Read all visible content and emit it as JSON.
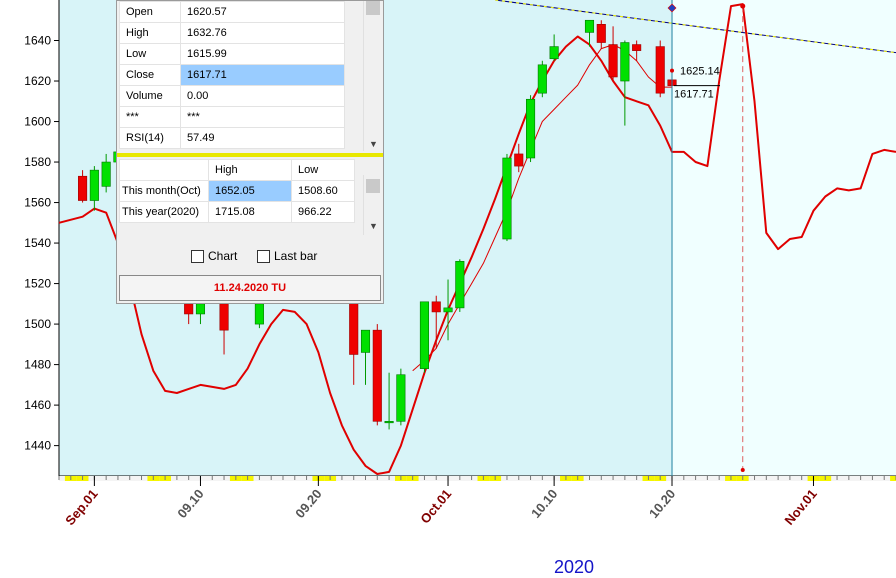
{
  "chart_data": {
    "type": "candlestick",
    "year_label": "2020",
    "x_tick_labels": [
      {
        "label": "Sep.01",
        "x": 0,
        "color": "#800000",
        "bold": true
      },
      {
        "label": "09.10",
        "x": 9,
        "color": "#555555",
        "bold": false
      },
      {
        "label": "09.20",
        "x": 19,
        "color": "#555555",
        "bold": false
      },
      {
        "label": "Oct.01",
        "x": 30,
        "color": "#800000",
        "bold": true
      },
      {
        "label": "10.10",
        "x": 39,
        "color": "#555555",
        "bold": false
      },
      {
        "label": "10.20",
        "x": 49,
        "color": "#555555",
        "bold": false
      },
      {
        "label": "Nov.01",
        "x": 61,
        "color": "#800000",
        "bold": true
      }
    ],
    "y_ticks": [
      1440,
      1460,
      1480,
      1500,
      1520,
      1540,
      1560,
      1580,
      1600,
      1620,
      1640
    ],
    "xlim": [
      -3,
      68
    ],
    "ylim": [
      1425,
      1660
    ],
    "candles": [
      {
        "x": -1,
        "open": 1573,
        "high": 1576,
        "low": 1560,
        "close": 1561
      },
      {
        "x": 0,
        "open": 1561,
        "high": 1578,
        "low": 1556,
        "close": 1576
      },
      {
        "x": 1,
        "open": 1568,
        "high": 1584,
        "low": 1565,
        "close": 1580
      },
      {
        "x": 2,
        "open": 1580,
        "high": 1590,
        "low": 1560,
        "close": 1585
      },
      {
        "x": 8,
        "open": 1510,
        "high": 1515,
        "low": 1500,
        "close": 1505
      },
      {
        "x": 9,
        "open": 1505,
        "high": 1515,
        "low": 1500,
        "close": 1510
      },
      {
        "x": 11,
        "open": 1510,
        "high": 1515,
        "low": 1485,
        "close": 1497
      },
      {
        "x": 14,
        "open": 1500,
        "high": 1512,
        "low": 1498,
        "close": 1510
      },
      {
        "x": 22,
        "open": 1515,
        "high": 1520,
        "low": 1470,
        "close": 1485
      },
      {
        "x": 23,
        "open": 1486,
        "high": 1497,
        "low": 1470,
        "close": 1497
      },
      {
        "x": 24,
        "open": 1497,
        "high": 1500,
        "low": 1450,
        "close": 1452
      },
      {
        "x": 25,
        "open": 1452,
        "high": 1476,
        "low": 1448,
        "close": 1452
      },
      {
        "x": 26,
        "open": 1452,
        "high": 1478,
        "low": 1450,
        "close": 1475
      },
      {
        "x": 28,
        "open": 1478,
        "high": 1510,
        "low": 1476,
        "close": 1511
      },
      {
        "x": 29,
        "open": 1511,
        "high": 1514,
        "low": 1488,
        "close": 1506
      },
      {
        "x": 30,
        "open": 1506,
        "high": 1522,
        "low": 1492,
        "close": 1508
      },
      {
        "x": 31,
        "open": 1508,
        "high": 1532,
        "low": 1506,
        "close": 1531
      },
      {
        "x": 35,
        "open": 1542,
        "high": 1584,
        "low": 1541,
        "close": 1582
      },
      {
        "x": 36,
        "open": 1584,
        "high": 1589,
        "low": 1575,
        "close": 1578
      },
      {
        "x": 37,
        "open": 1582,
        "high": 1613,
        "low": 1580,
        "close": 1611
      },
      {
        "x": 38,
        "open": 1614,
        "high": 1630,
        "low": 1612,
        "close": 1628
      },
      {
        "x": 39,
        "open": 1631,
        "high": 1643,
        "low": 1630,
        "close": 1637
      },
      {
        "x": 42,
        "open": 1644,
        "high": 1650,
        "low": 1637,
        "close": 1650
      },
      {
        "x": 43,
        "open": 1648,
        "high": 1650,
        "low": 1636,
        "close": 1639
      },
      {
        "x": 44,
        "open": 1638,
        "high": 1647,
        "low": 1620,
        "close": 1622
      },
      {
        "x": 45,
        "open": 1620,
        "high": 1640,
        "low": 1598,
        "close": 1639
      },
      {
        "x": 46,
        "open": 1638,
        "high": 1640,
        "low": 1630,
        "close": 1635
      },
      {
        "x": 48,
        "open": 1637,
        "high": 1640,
        "low": 1612,
        "close": 1614
      },
      {
        "x": 49,
        "open": 1620.57,
        "high": 1632.76,
        "low": 1615.99,
        "close": 1617.71
      }
    ],
    "ma_long": [
      [
        -3,
        1550
      ],
      [
        -1,
        1553
      ],
      [
        0,
        1557
      ],
      [
        1,
        1555
      ],
      [
        2,
        1540
      ],
      [
        3,
        1520
      ],
      [
        4,
        1495
      ],
      [
        5,
        1477
      ],
      [
        6,
        1467
      ],
      [
        7,
        1466
      ],
      [
        8,
        1468
      ],
      [
        9,
        1470
      ],
      [
        10,
        1469
      ],
      [
        11,
        1468
      ],
      [
        12,
        1470
      ],
      [
        13,
        1478
      ],
      [
        14,
        1490
      ],
      [
        15,
        1500
      ],
      [
        16,
        1507
      ],
      [
        17,
        1506
      ],
      [
        18,
        1500
      ],
      [
        19,
        1486
      ],
      [
        20,
        1466
      ],
      [
        21,
        1450
      ],
      [
        22,
        1438
      ],
      [
        23,
        1430
      ],
      [
        24,
        1426
      ],
      [
        25,
        1427
      ],
      [
        26,
        1440
      ],
      [
        27,
        1458
      ],
      [
        28,
        1476
      ],
      [
        29,
        1492
      ],
      [
        30,
        1507
      ],
      [
        31,
        1520
      ],
      [
        32,
        1533
      ],
      [
        33,
        1547
      ],
      [
        34,
        1562
      ],
      [
        35,
        1578
      ],
      [
        36,
        1594
      ],
      [
        37,
        1609
      ],
      [
        38,
        1620
      ],
      [
        39,
        1630
      ],
      [
        40,
        1637
      ],
      [
        41,
        1642
      ],
      [
        42,
        1638
      ],
      [
        43,
        1630
      ],
      [
        44,
        1620
      ],
      [
        45,
        1612
      ],
      [
        46,
        1610
      ],
      [
        47,
        1608
      ],
      [
        48,
        1598
      ],
      [
        49,
        1585
      ],
      [
        50,
        1585
      ],
      [
        51,
        1580
      ],
      [
        52,
        1578
      ],
      [
        53,
        1620
      ],
      [
        54,
        1657
      ],
      [
        55,
        1658
      ],
      [
        56,
        1610
      ],
      [
        57,
        1545
      ],
      [
        58,
        1537
      ],
      [
        59,
        1542
      ],
      [
        60,
        1543
      ],
      [
        61,
        1556
      ],
      [
        62,
        1563
      ],
      [
        63,
        1567
      ],
      [
        64,
        1566
      ],
      [
        65,
        1567
      ],
      [
        66,
        1584
      ],
      [
        67,
        1586
      ],
      [
        68,
        1585
      ]
    ],
    "ma_short": [
      [
        27,
        1477
      ],
      [
        28,
        1482
      ],
      [
        29,
        1488
      ],
      [
        30,
        1500
      ],
      [
        31,
        1510
      ],
      [
        32,
        1520
      ],
      [
        33,
        1530
      ],
      [
        34,
        1543
      ],
      [
        35,
        1556
      ],
      [
        36,
        1572
      ],
      [
        37,
        1586
      ],
      [
        38,
        1600
      ],
      [
        39,
        1606
      ],
      [
        40,
        1612
      ],
      [
        41,
        1618
      ],
      [
        42,
        1628
      ],
      [
        43,
        1636
      ],
      [
        44,
        1638
      ],
      [
        45,
        1635
      ],
      [
        46,
        1630
      ],
      [
        47,
        1622
      ],
      [
        48,
        1617
      ],
      [
        49,
        1617
      ]
    ],
    "trend_line": [
      [
        34,
        1660
      ],
      [
        68,
        1634
      ]
    ],
    "cursor_x": 49,
    "future_marker_x": 55,
    "price_labels": [
      "1625.14",
      "1617.71"
    ],
    "price_label_values": [
      1625.14,
      1617.71
    ]
  },
  "panel": {
    "rows": [
      {
        "label": "Open",
        "value": "1620.57"
      },
      {
        "label": "High",
        "value": "1632.76"
      },
      {
        "label": "Low",
        "value": "1615.99"
      },
      {
        "label": "Close",
        "value": "1617.71"
      },
      {
        "label": "Volume",
        "value": "0.00"
      },
      {
        "label": "***",
        "value": "***"
      },
      {
        "label": "RSI(14)",
        "value": "57.49"
      }
    ],
    "range_headers": {
      "high": "High",
      "low": "Low"
    },
    "ranges": [
      {
        "label": "This month(Oct)",
        "high": "1652.05",
        "low": "1508.60"
      },
      {
        "label": "This year(2020)",
        "high": "1715.08",
        "low": "966.22"
      }
    ],
    "chart_checkbox_label": "Chart",
    "lastbar_checkbox_label": "Last bar",
    "date_label": "11.24.2020 TU"
  }
}
